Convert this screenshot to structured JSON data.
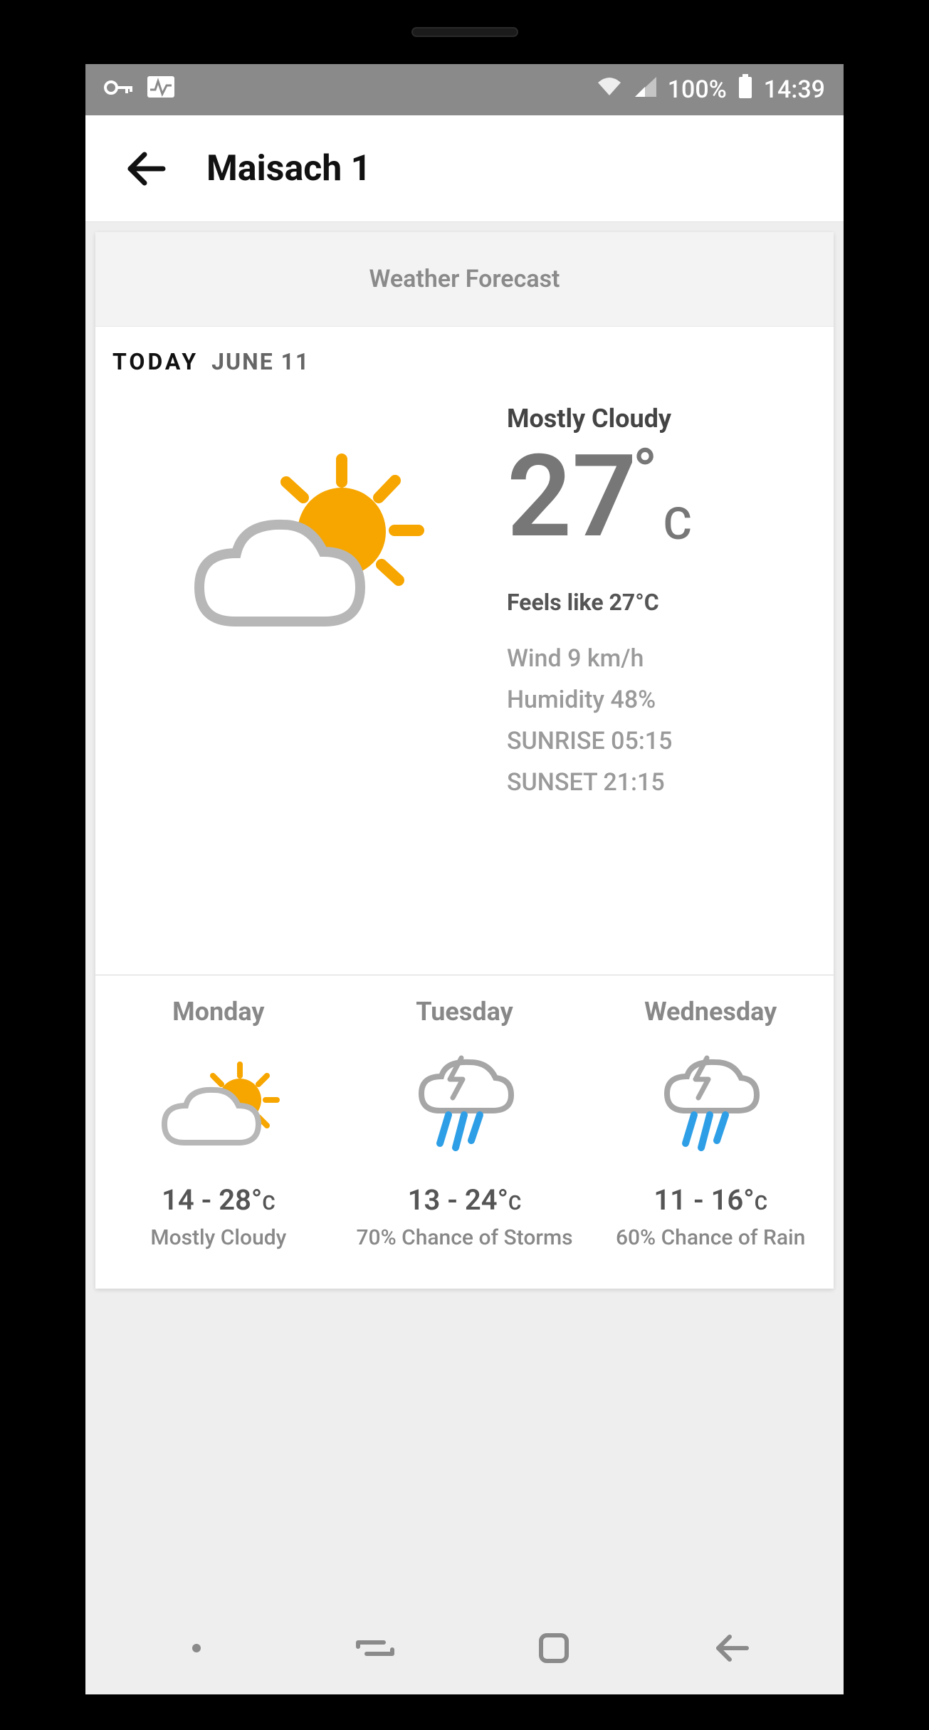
{
  "statusbar": {
    "battery_pct": "100%",
    "time": "14:39"
  },
  "appbar": {
    "title": "Maisach 1"
  },
  "card": {
    "header": "Weather Forecast"
  },
  "today": {
    "label": "TODAY",
    "date": "JUNE  11",
    "condition": "Mostly Cloudy",
    "temp_value": "27",
    "temp_deg": "°",
    "temp_unit": "C",
    "feels_like": "Feels like 27°C",
    "wind": "Wind 9 km/h",
    "humidity": "Humidity 48%",
    "sunrise": "SUNRISE 05:15",
    "sunset": "SUNSET 21:15"
  },
  "forecast": [
    {
      "day": "Monday",
      "icon": "partly-cloudy",
      "temps": "14 - 28°",
      "unit": "C",
      "condition": "Mostly Cloudy"
    },
    {
      "day": "Tuesday",
      "icon": "thunder-rain",
      "temps": "13 - 24°",
      "unit": "C",
      "condition": "70% Chance of Storms"
    },
    {
      "day": "Wednesday",
      "icon": "thunder-rain",
      "temps": "11 - 16°",
      "unit": "C",
      "condition": "60% Chance of Rain"
    }
  ]
}
